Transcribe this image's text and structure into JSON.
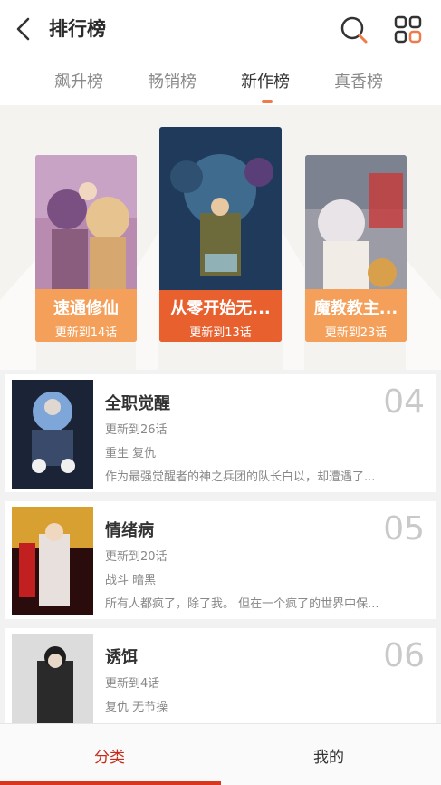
{
  "header": {
    "title": "排行榜"
  },
  "tabs": [
    {
      "label": "飙升榜"
    },
    {
      "label": "畅销榜"
    },
    {
      "label": "新作榜"
    },
    {
      "label": "真香榜"
    }
  ],
  "podium": [
    {
      "name": "速通修仙",
      "update": "更新到14话"
    },
    {
      "name": "从零开始无...",
      "update": "更新到13话"
    },
    {
      "name": "魔教教主...",
      "update": "更新到23话"
    }
  ],
  "list": [
    {
      "name": "全职觉醒",
      "rank": "04",
      "update": "更新到26话",
      "tags": "重生 复仇",
      "desc": "作为最强觉醒者的神之兵团的队长白以，却遭遇了..."
    },
    {
      "name": "情绪病",
      "rank": "05",
      "update": "更新到20话",
      "tags": "战斗 暗黑",
      "desc": "所有人都疯了，除了我。 但在一个疯了的世界中保..."
    },
    {
      "name": "诱饵",
      "rank": "06",
      "update": "更新到4话",
      "tags": "复仇 无节操",
      "desc": ""
    }
  ],
  "bottom_nav": {
    "tab1": "分类",
    "tab2": "我的"
  },
  "colors": {
    "accent": "#f07a4a",
    "active_bottom": "#c72a1a",
    "podium_bar": "#f5a05a",
    "podium_bar_center": "#e8602e"
  }
}
